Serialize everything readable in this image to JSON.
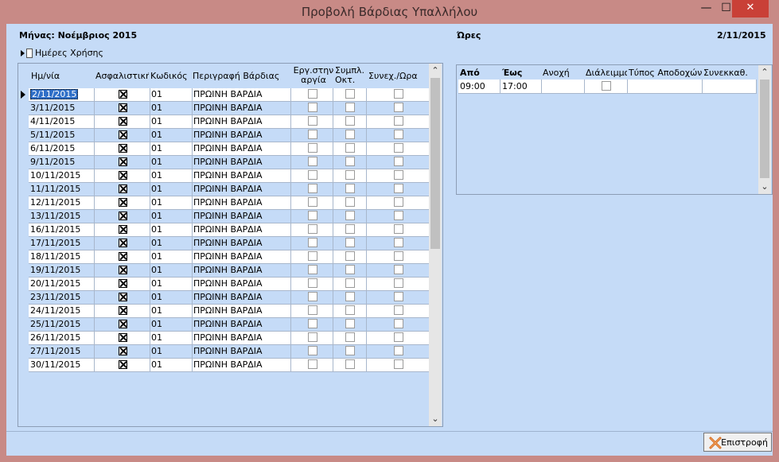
{
  "window": {
    "title": "Προβολή Βάρδιας Υπαλλήλου",
    "min_glyph": "—",
    "max_glyph": "☐",
    "close_glyph": "✕"
  },
  "left": {
    "month_label": "Μήνας: Νοέμβριος 2015",
    "days_toggle_label": "Ημέρες Χρήσης",
    "columns": {
      "date": "Ημ/νία",
      "insurance": "Ασφαλιστική",
      "code": "Κωδικός",
      "description": "Περιγραφή Βάρδιας",
      "holiday_work_l1": "Εργ.στην",
      "holiday_work_l2": "αργία",
      "eight_hour_l1": "Συμπλ.",
      "eight_hour_l2": "Οκτ.",
      "continuous": "Συνεχ./Ωρα"
    },
    "rows": [
      {
        "date": "2/11/2015",
        "insurance": true,
        "code": "01",
        "description": "ΠΡΩΙΝΗ ΒΑΡΔΙΑ"
      },
      {
        "date": "3/11/2015",
        "insurance": true,
        "code": "01",
        "description": "ΠΡΩΙΝΗ ΒΑΡΔΙΑ"
      },
      {
        "date": "4/11/2015",
        "insurance": true,
        "code": "01",
        "description": "ΠΡΩΙΝΗ ΒΑΡΔΙΑ"
      },
      {
        "date": "5/11/2015",
        "insurance": true,
        "code": "01",
        "description": "ΠΡΩΙΝΗ ΒΑΡΔΙΑ"
      },
      {
        "date": "6/11/2015",
        "insurance": true,
        "code": "01",
        "description": "ΠΡΩΙΝΗ ΒΑΡΔΙΑ"
      },
      {
        "date": "9/11/2015",
        "insurance": true,
        "code": "01",
        "description": "ΠΡΩΙΝΗ ΒΑΡΔΙΑ"
      },
      {
        "date": "10/11/2015",
        "insurance": true,
        "code": "01",
        "description": "ΠΡΩΙΝΗ ΒΑΡΔΙΑ"
      },
      {
        "date": "11/11/2015",
        "insurance": true,
        "code": "01",
        "description": "ΠΡΩΙΝΗ ΒΑΡΔΙΑ"
      },
      {
        "date": "12/11/2015",
        "insurance": true,
        "code": "01",
        "description": "ΠΡΩΙΝΗ ΒΑΡΔΙΑ"
      },
      {
        "date": "13/11/2015",
        "insurance": true,
        "code": "01",
        "description": "ΠΡΩΙΝΗ ΒΑΡΔΙΑ"
      },
      {
        "date": "16/11/2015",
        "insurance": true,
        "code": "01",
        "description": "ΠΡΩΙΝΗ ΒΑΡΔΙΑ"
      },
      {
        "date": "17/11/2015",
        "insurance": true,
        "code": "01",
        "description": "ΠΡΩΙΝΗ ΒΑΡΔΙΑ"
      },
      {
        "date": "18/11/2015",
        "insurance": true,
        "code": "01",
        "description": "ΠΡΩΙΝΗ ΒΑΡΔΙΑ"
      },
      {
        "date": "19/11/2015",
        "insurance": true,
        "code": "01",
        "description": "ΠΡΩΙΝΗ ΒΑΡΔΙΑ"
      },
      {
        "date": "20/11/2015",
        "insurance": true,
        "code": "01",
        "description": "ΠΡΩΙΝΗ ΒΑΡΔΙΑ"
      },
      {
        "date": "23/11/2015",
        "insurance": true,
        "code": "01",
        "description": "ΠΡΩΙΝΗ ΒΑΡΔΙΑ"
      },
      {
        "date": "24/11/2015",
        "insurance": true,
        "code": "01",
        "description": "ΠΡΩΙΝΗ ΒΑΡΔΙΑ"
      },
      {
        "date": "25/11/2015",
        "insurance": true,
        "code": "01",
        "description": "ΠΡΩΙΝΗ ΒΑΡΔΙΑ"
      },
      {
        "date": "26/11/2015",
        "insurance": true,
        "code": "01",
        "description": "ΠΡΩΙΝΗ ΒΑΡΔΙΑ"
      },
      {
        "date": "27/11/2015",
        "insurance": true,
        "code": "01",
        "description": "ΠΡΩΙΝΗ ΒΑΡΔΙΑ"
      },
      {
        "date": "30/11/2015",
        "insurance": true,
        "code": "01",
        "description": "ΠΡΩΙΝΗ ΒΑΡΔΙΑ"
      }
    ]
  },
  "right": {
    "label": "Ώρες",
    "date": "2/11/2015",
    "columns": {
      "from": "Από",
      "to": "Έως",
      "tolerance": "Ανοχή",
      "break": "Διάλειμμα",
      "pay_type": "Τύπος Αποδοχών",
      "co_calc": "Συνεκκαθ."
    },
    "rows": [
      {
        "from": "09:00",
        "to": "17:00",
        "tolerance": "",
        "break": false,
        "pay_type": "",
        "co_calc": ""
      }
    ]
  },
  "footer": {
    "return_label": "Επιστροφή"
  },
  "colors": {
    "title_bar": "#c88a86",
    "client_bg": "#c5dbf7",
    "selected": "#2f6fc7",
    "close": "#c94037"
  }
}
